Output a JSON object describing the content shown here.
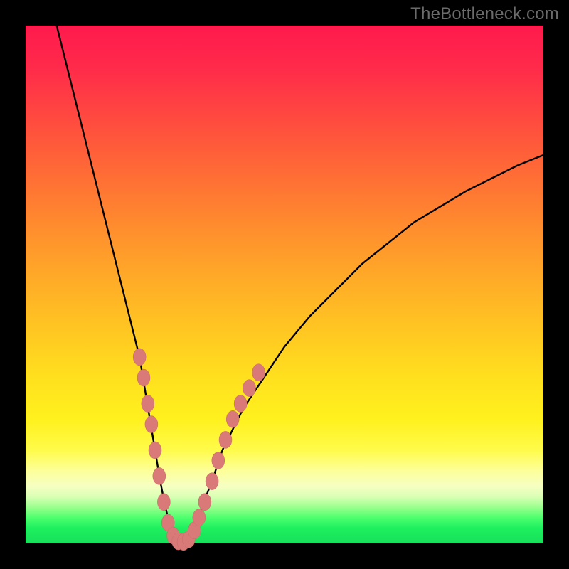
{
  "watermark": "TheBottleneck.com",
  "colors": {
    "curve_stroke": "#000000",
    "marker_fill": "#d97a78",
    "marker_stroke": "#c66a68",
    "gradient_top": "#ff1a4d",
    "gradient_mid": "#ffe01e",
    "gradient_bottom": "#17e05a",
    "frame": "#000000"
  },
  "chart_data": {
    "type": "line",
    "title": "",
    "xlabel": "",
    "ylabel": "",
    "xlim": [
      0,
      100
    ],
    "ylim": [
      0,
      100
    ],
    "note": "Axes ungraduated; curve is a V-shaped bottleneck curve with minimum near x≈30, y≈0. Values estimated from pixel positions.",
    "series": [
      {
        "name": "bottleneck-curve",
        "x": [
          6,
          8,
          10,
          12,
          14,
          16,
          18,
          20,
          22,
          24,
          25,
          26,
          27,
          28,
          29,
          30,
          31,
          32,
          33,
          34,
          36,
          38,
          42,
          46,
          50,
          55,
          60,
          65,
          70,
          75,
          80,
          85,
          90,
          95,
          100
        ],
        "y": [
          100,
          92,
          84,
          76,
          68,
          60,
          52,
          44,
          36,
          24,
          18,
          12,
          7,
          3,
          1,
          0,
          1,
          2,
          4,
          7,
          12,
          18,
          26,
          32,
          38,
          44,
          49,
          54,
          58,
          62,
          65,
          68,
          70.5,
          73,
          75
        ]
      }
    ],
    "markers": [
      {
        "x": 22.0,
        "y": 36
      },
      {
        "x": 22.8,
        "y": 32
      },
      {
        "x": 23.6,
        "y": 27
      },
      {
        "x": 24.3,
        "y": 23
      },
      {
        "x": 25.0,
        "y": 18
      },
      {
        "x": 25.8,
        "y": 13
      },
      {
        "x": 26.7,
        "y": 8
      },
      {
        "x": 27.5,
        "y": 4
      },
      {
        "x": 28.5,
        "y": 1.5
      },
      {
        "x": 29.5,
        "y": 0.4
      },
      {
        "x": 30.5,
        "y": 0.3
      },
      {
        "x": 31.5,
        "y": 0.8
      },
      {
        "x": 32.6,
        "y": 2.5
      },
      {
        "x": 33.5,
        "y": 5
      },
      {
        "x": 34.6,
        "y": 8
      },
      {
        "x": 36.0,
        "y": 12
      },
      {
        "x": 37.2,
        "y": 16
      },
      {
        "x": 38.6,
        "y": 20
      },
      {
        "x": 40.0,
        "y": 24
      },
      {
        "x": 41.5,
        "y": 27
      },
      {
        "x": 43.2,
        "y": 30
      },
      {
        "x": 45.0,
        "y": 33
      }
    ]
  }
}
